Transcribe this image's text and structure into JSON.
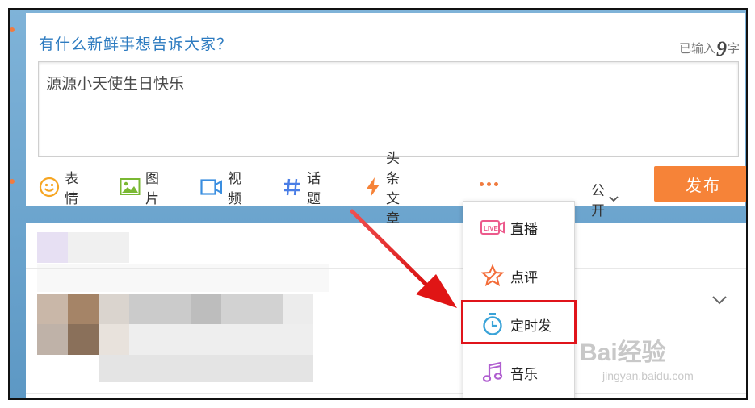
{
  "composer": {
    "prompt": "有什么新鲜事想告诉大家？",
    "counter_prefix": "已输入",
    "counter_value": "9",
    "counter_suffix": "字",
    "text": "源源小天使生日快乐"
  },
  "toolbar": {
    "emoji": "表情",
    "image": "图片",
    "video": "视频",
    "topic": "话题",
    "article": "头条文章",
    "visibility": "公开",
    "publish": "发布"
  },
  "menu": {
    "items": [
      "直播",
      "点评",
      "定时发",
      "音乐"
    ]
  },
  "watermark": {
    "brand": "Bai经验",
    "url": "jingyan.baidu.com"
  },
  "colors": {
    "accent_orange": "#f68338",
    "highlight_red": "#e0141b",
    "prompt_blue": "#2d7bc0"
  }
}
